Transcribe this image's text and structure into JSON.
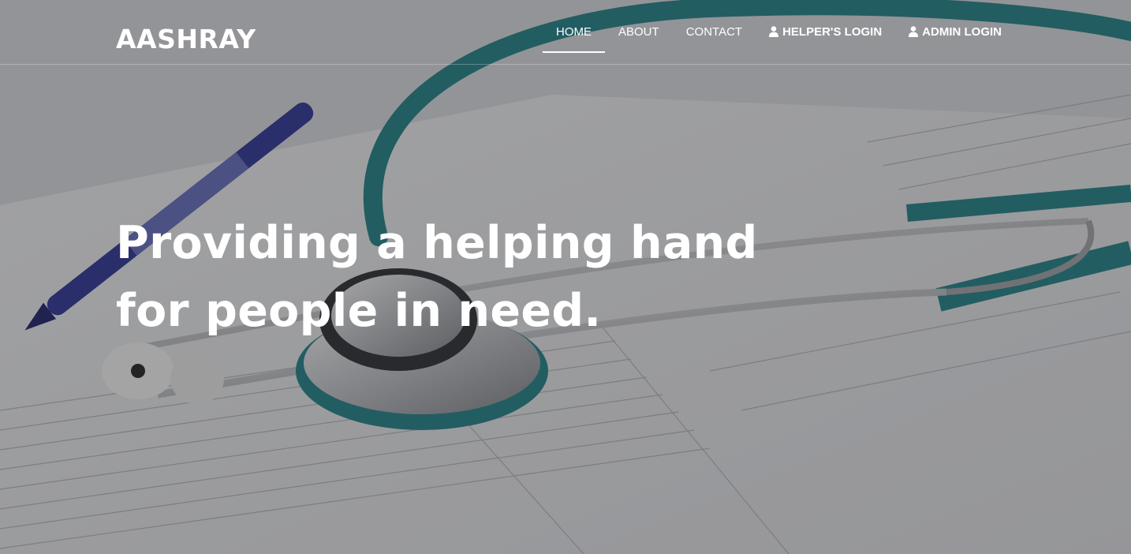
{
  "brand": {
    "name": "AASHRAY"
  },
  "nav": {
    "items": [
      {
        "label": "HOME",
        "active": true,
        "icon": null
      },
      {
        "label": "ABOUT",
        "active": false,
        "icon": null
      },
      {
        "label": "CONTACT",
        "active": false,
        "icon": null
      },
      {
        "label": "HELPER'S LOGIN",
        "active": false,
        "icon": "user-icon"
      },
      {
        "label": "ADMIN LOGIN",
        "active": false,
        "icon": "user-icon"
      }
    ]
  },
  "hero": {
    "line1": "Providing a helping hand",
    "line2": "for people in need.",
    "image": "stethoscope-on-medical-chart-photo"
  },
  "colors": {
    "text": "#ffffff",
    "stethoscope_tube": "#1f7e83",
    "pen": "#2a2f8f",
    "paper": "#e6e7e8"
  }
}
